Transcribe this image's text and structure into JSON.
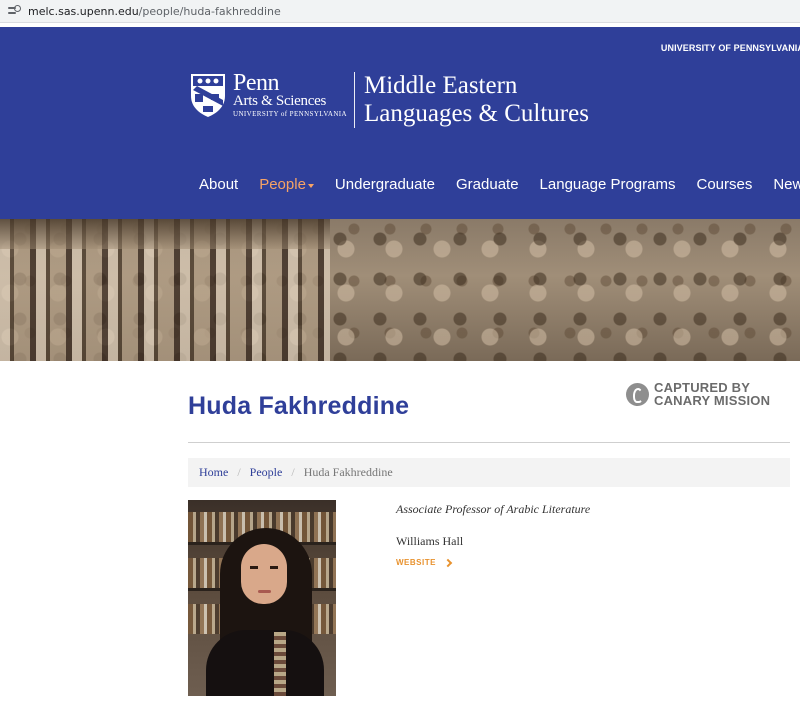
{
  "browser": {
    "url_host": "melc.sas.upenn.edu",
    "url_path": "/people/huda-fakhreddine"
  },
  "header": {
    "university_link": "UNIVERSITY OF PENNSYLVANIA",
    "logo_penn": "Penn",
    "logo_arts": "Arts & Sciences",
    "logo_university": "UNIVERSITY of PENNSYLVANIA",
    "dept_line1": "Middle Eastern",
    "dept_line2": "Languages & Cultures",
    "brand_color": "#2f3f99",
    "nav": [
      {
        "label": "About"
      },
      {
        "label": "People"
      },
      {
        "label": "Undergraduate"
      },
      {
        "label": "Graduate"
      },
      {
        "label": "Language Programs"
      },
      {
        "label": "Courses"
      },
      {
        "label": "News"
      }
    ],
    "nav_active_color": "#f7a365"
  },
  "badge": {
    "line1": "CAPTURED BY",
    "line2": "CANARY MISSION"
  },
  "profile": {
    "name": "Huda Fakhreddine",
    "title": "Associate Professor of Arabic Literature",
    "office": "Williams Hall",
    "website_label": "WEBSITE"
  },
  "breadcrumb": {
    "home": "Home",
    "people": "People",
    "current": "Huda Fakhreddine"
  }
}
